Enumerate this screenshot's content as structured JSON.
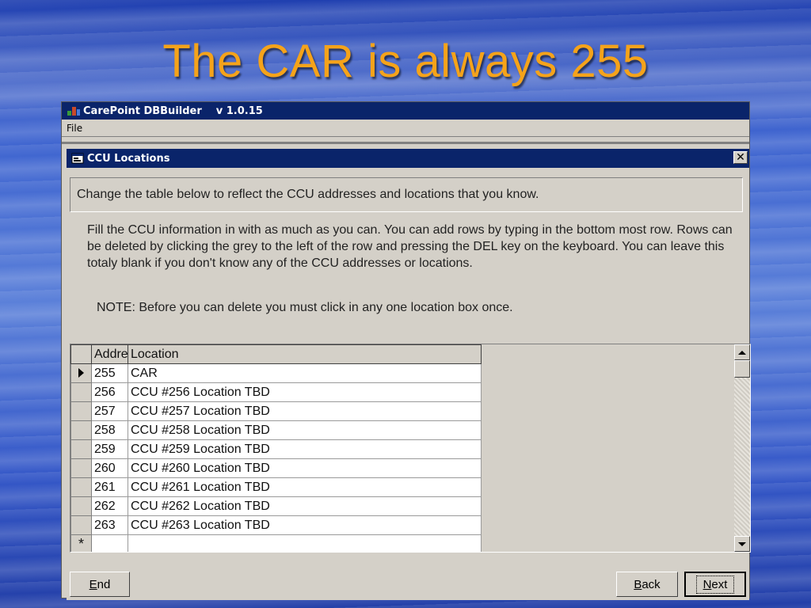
{
  "slide": {
    "title": "The CAR is always 255"
  },
  "app": {
    "title": "CarePoint DBBuilder",
    "version": "v 1.0.15",
    "menu": {
      "file": "File"
    }
  },
  "dialog": {
    "title": "CCU Locations",
    "close": "✕",
    "header": "Change the table below to reflect the CCU addresses and locations that you know.",
    "instructions": "Fill the CCU information in with as much as you can.  You can add rows by typing in the bottom most row.  Rows can be deleted by clicking the grey to the left of the row and pressing the DEL key on the keyboard.  You can leave this totaly blank if you don't know any of the CCU addresses or locations.",
    "note": "NOTE: Before you can delete you must click in any one location box once."
  },
  "grid": {
    "columns": {
      "address": "Address",
      "location": "Location"
    },
    "rows": [
      {
        "address": "255",
        "location": "CAR",
        "current": true
      },
      {
        "address": "256",
        "location": "CCU #256 Location TBD"
      },
      {
        "address": "257",
        "location": "CCU #257 Location TBD"
      },
      {
        "address": "258",
        "location": "CCU #258 Location TBD"
      },
      {
        "address": "259",
        "location": "CCU #259 Location TBD"
      },
      {
        "address": "260",
        "location": "CCU #260 Location TBD"
      },
      {
        "address": "261",
        "location": "CCU #261 Location TBD"
      },
      {
        "address": "262",
        "location": "CCU #262 Location TBD"
      },
      {
        "address": "263",
        "location": "CCU #263 Location TBD"
      }
    ],
    "new_row_marker": "*"
  },
  "buttons": {
    "end": {
      "hot": "E",
      "rest": "nd"
    },
    "back": {
      "hot": "B",
      "rest": "ack"
    },
    "next": {
      "hot": "N",
      "rest": "ext"
    }
  }
}
